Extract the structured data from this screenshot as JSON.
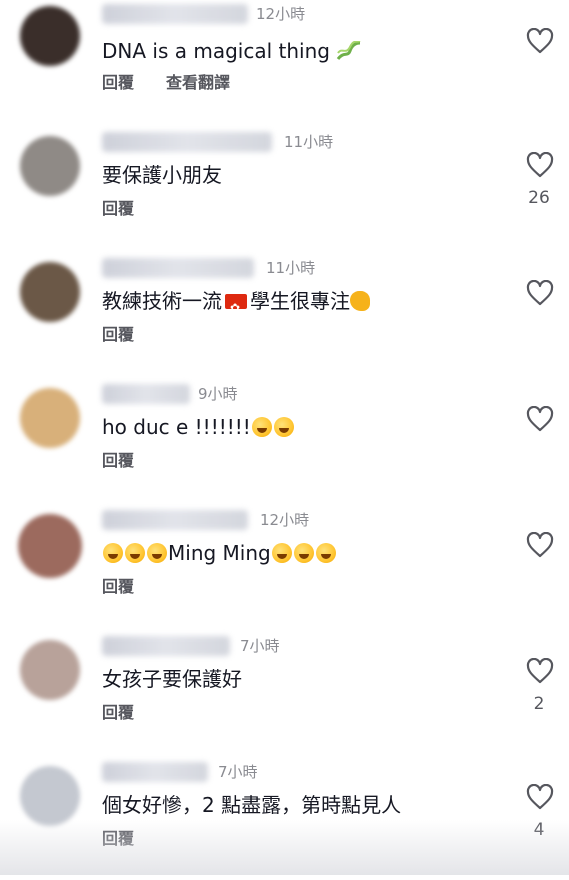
{
  "comments": [
    {
      "time": "12小時",
      "text": "DNA is a magical thing",
      "reply": "回覆",
      "translate": "查看翻譯",
      "likes": "",
      "avatar_color": "#3a2e2a",
      "emojis": "dna"
    },
    {
      "time": "11小時",
      "text": "要保護小朋友",
      "reply": "回覆",
      "likes": "26",
      "avatar_color": "#8f8a86"
    },
    {
      "time": "11小時",
      "text_a": "教練技術一流",
      "text_b": "學生很專注",
      "reply": "回覆",
      "likes": "",
      "avatar_color": "#6b5847"
    },
    {
      "time": "9小時",
      "text": "ho duc e !!!!!!!",
      "reply": "回覆",
      "likes": "",
      "avatar_color": "#d8b07a"
    },
    {
      "time": "12小時",
      "text": "Ming Ming",
      "reply": "回覆",
      "likes": "",
      "avatar_color": "#9c6a5e"
    },
    {
      "time": "7小時",
      "text": "女孩子要保護好",
      "reply": "回覆",
      "likes": "2",
      "avatar_color": "#b8a29a"
    },
    {
      "time": "7小時",
      "text": "個女好慘，2 點盡露，第時點見人",
      "reply": "回覆",
      "likes": "4",
      "avatar_color": "#c4c8d0"
    }
  ],
  "icons": {
    "like": "heart-outline-icon"
  },
  "colors": {
    "text": "#161823",
    "secondary": "#56575e",
    "time": "#8a8b91"
  }
}
